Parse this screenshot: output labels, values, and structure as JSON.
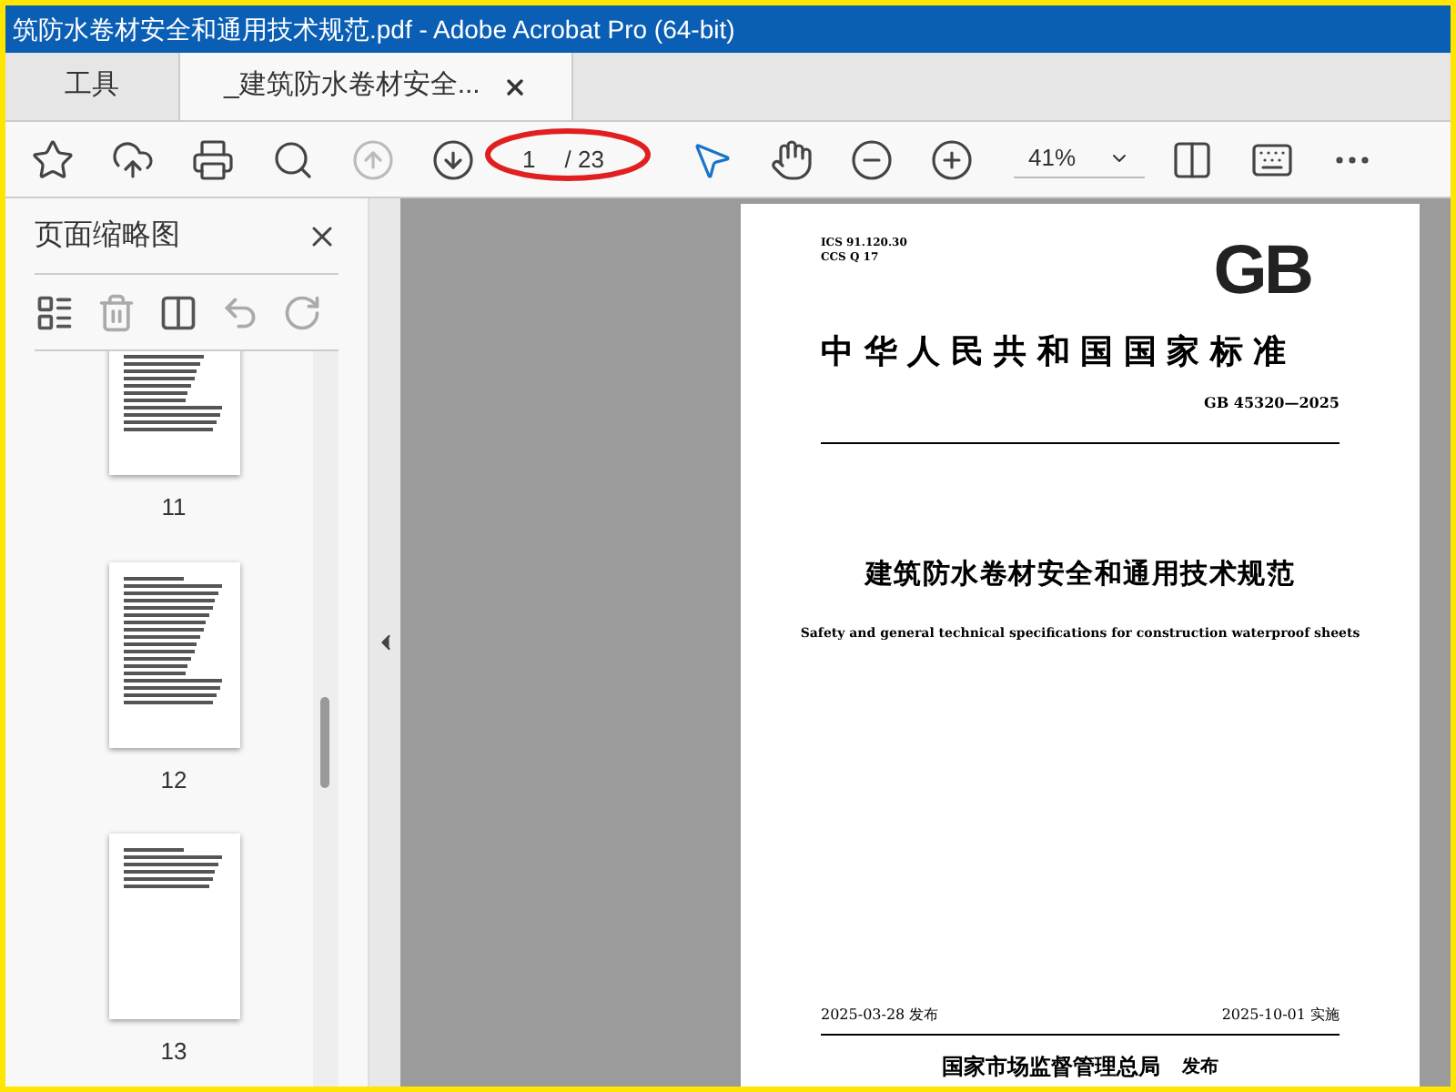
{
  "window": {
    "title": "筑防水卷材安全和通用技术规范.pdf - Adobe Acrobat Pro (64-bit)"
  },
  "tabs": [
    {
      "label": "工具",
      "selected": false
    },
    {
      "label": "_建筑防水卷材安全...",
      "selected": true
    }
  ],
  "toolbar": {
    "page": "1",
    "total": "/ 23",
    "zoom": "41%"
  },
  "sidebar": {
    "title": "页面缩略图",
    "thumbnails": [
      {
        "label": "11"
      },
      {
        "label": "12"
      },
      {
        "label": "13"
      }
    ]
  },
  "document": {
    "ics": "ICS 91.120.30",
    "ccs": "CCS Q 17",
    "logo": "GB",
    "heading": "中华人民共和国国家标准",
    "code": "GB 45320—2025",
    "title_cn": "建筑防水卷材安全和通用技术规范",
    "title_en": "Safety and general technical specifications for construction waterproof sheets",
    "issue_date": "2025-03-28 发布",
    "effective_date": "2025-10-01 实施",
    "issuer": "国家市场监督管理总局",
    "issuer_action": "发布"
  }
}
